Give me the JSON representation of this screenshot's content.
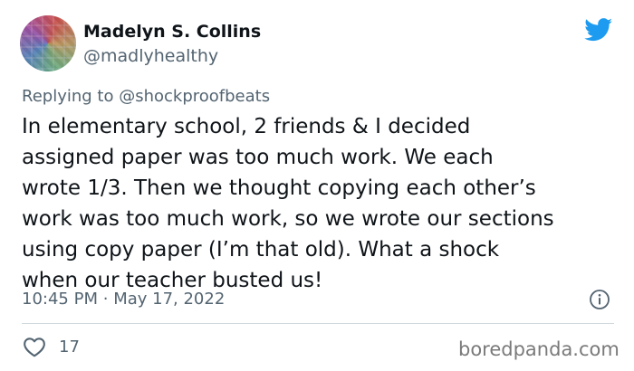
{
  "author": {
    "display_name": "Madelyn S. Collins",
    "handle": "@madlyhealthy",
    "avatar": "colorful-patchwork-avatar"
  },
  "header": {
    "platform_icon": "twitter-bird-icon",
    "brand_color": "#1d9bf0"
  },
  "reply": {
    "prefix": "Replying to",
    "mention": "@shockproofbeats"
  },
  "tweet": {
    "lines": [
      "In elementary school, 2 friends & I decided",
      "assigned paper was too much work. We each",
      "wrote 1/3. Then we thought copying each other’s",
      "work was too much work, so we wrote our sections",
      "using copy paper (I’m that old). What a shock",
      "when our teacher busted us!"
    ]
  },
  "meta": {
    "time": "10:45 PM",
    "separator": "·",
    "date": "May 17, 2022",
    "info_icon": "info-icon"
  },
  "actions": {
    "like_icon": "heart-icon",
    "like_count": "17"
  },
  "watermark": "boredpanda.com",
  "colors": {
    "text_primary": "#0f1419",
    "text_secondary": "#536471",
    "divider": "#cfd9de"
  }
}
